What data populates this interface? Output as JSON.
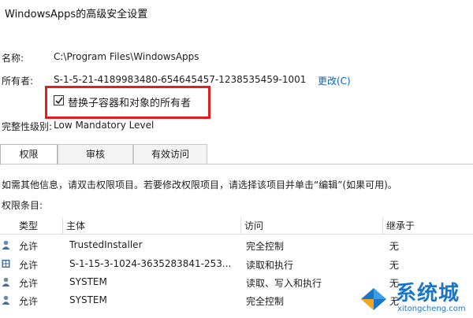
{
  "window": {
    "title": "WindowsApps的高级安全设置"
  },
  "name_row": {
    "label": "名称:",
    "value": "C:\\Program Files\\WindowsApps"
  },
  "owner_row": {
    "label": "所有者:",
    "value": "S-1-5-21-4189983480-654645457-1238535459-1001",
    "change_link": "更改(C)"
  },
  "replace_owner": {
    "label": "替换子容器和对象的所有者",
    "checked": true
  },
  "integrity_row": {
    "label": "完整性级别:",
    "value": "Low Mandatory Level"
  },
  "tabs": [
    {
      "label": "权限",
      "active": true
    },
    {
      "label": "审核",
      "active": false
    },
    {
      "label": "有效访问",
      "active": false
    }
  ],
  "info_text": "如需其他信息，请双击权限项目。若要修改权限项目，请选择该项目并单击“编辑”(如果可用)。",
  "entries_label": "权限条目:",
  "columns": [
    "类型",
    "主体",
    "访问",
    "继承于"
  ],
  "entries": [
    {
      "icon": "user-icon",
      "type": "允许",
      "principal": "TrustedInstaller",
      "access": "完全控制",
      "inherited": "无"
    },
    {
      "icon": "package-icon",
      "type": "允许",
      "principal": "S-1-15-3-1024-3635283841-253...",
      "access": "读取和执行",
      "inherited": "无"
    },
    {
      "icon": "user-icon",
      "type": "允许",
      "principal": "SYSTEM",
      "access": "读取、写入和执行",
      "inherited": "无"
    },
    {
      "icon": "user-icon",
      "type": "允许",
      "principal": "SYSTEM",
      "access": "完全控制",
      "inherited": "无"
    }
  ],
  "watermark": {
    "brand": "系统城",
    "url": "xitongcheng.com"
  },
  "colors": {
    "highlight": "#e02020",
    "link": "#0066cc",
    "watermark": "#1b75c7"
  }
}
